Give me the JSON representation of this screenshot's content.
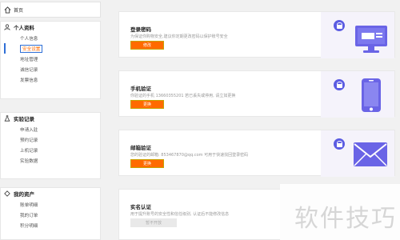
{
  "sidebar": {
    "home_label": "首页",
    "groups": [
      {
        "title": "个人资料",
        "icon": "user-icon",
        "items": [
          "个人信息",
          "安全设置",
          "地址管理",
          "诚信记录",
          "发票信息"
        ],
        "active_index": 1
      },
      {
        "title": "实验记录",
        "icon": "flask-icon",
        "items": [
          "申请入驻",
          "预约记录",
          "上机记录",
          "实验数据"
        ]
      },
      {
        "title": "我的资产",
        "icon": "diamond-icon",
        "items": [
          "账单明细",
          "我的订单",
          "积分明细"
        ]
      }
    ]
  },
  "cards": [
    {
      "title": "登录密码",
      "desc": "为保证你购物安全,建议你定期更改密码以保护账号安全",
      "button": "修改",
      "icon": "monitor-icon"
    },
    {
      "title": "手机验证",
      "desc": "你验证的手机 13660355201 若已丢失或停用, 请立如更换",
      "button": "更换",
      "icon": "phone-icon"
    },
    {
      "title": "邮箱验证",
      "desc": "您的验证的邮箱: 853467870@qq.com 可用于快速找回登录密码",
      "button": "更换",
      "icon": "mail-icon"
    },
    {
      "title": "实名认证",
      "desc": "用于提升账号的安全性和信任级别, 认证后不能修改信息",
      "button": "暂不开放",
      "button_disabled": true
    }
  ],
  "watermark": "软件技巧",
  "colors": {
    "accent": "#ff6a00",
    "icon_purple": "#5b5ce2",
    "active_border": "#2f6fd6"
  }
}
